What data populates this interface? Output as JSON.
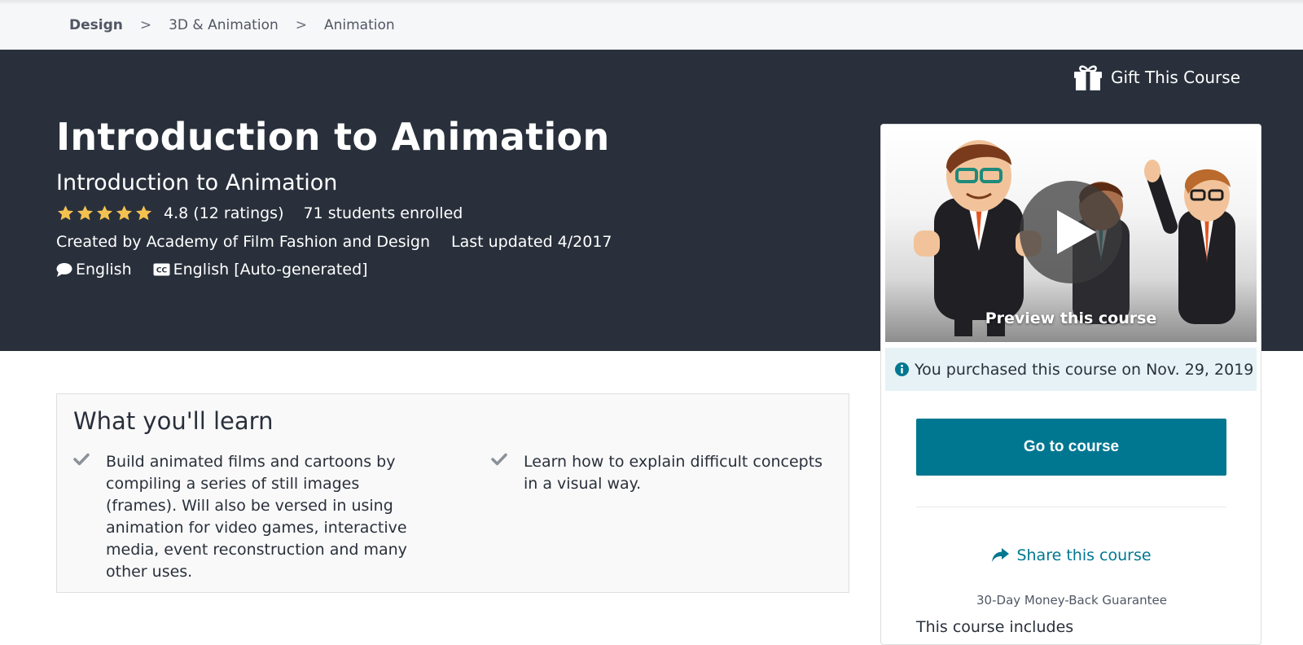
{
  "breadcrumb": [
    {
      "label": "Design"
    },
    {
      "label": "3D & Animation"
    },
    {
      "label": "Animation"
    }
  ],
  "breadcrumb_separator": ">",
  "hero": {
    "gift_label": "Gift This Course",
    "title": "Introduction to Animation",
    "subtitle": "Introduction to Animation",
    "rating": 4.8,
    "rating_label": "4.8 (12 ratings)",
    "stars_filled": 5,
    "enrolled": "71 students enrolled",
    "created_by": "Created by Academy of Film Fashion and Design",
    "last_updated": "Last updated 4/2017",
    "language": "English",
    "captions": "English [Auto-generated]"
  },
  "sidebar": {
    "preview_label": "Preview this course",
    "purchased_notice": "You purchased this course on Nov. 29, 2019",
    "go_button": "Go to course",
    "share_label": "Share this course",
    "guarantee": "30-Day Money-Back Guarantee",
    "includes_title": "This course includes"
  },
  "learn": {
    "title": "What you'll learn",
    "items": [
      "Build animated films and cartoons by compiling a series of still images (frames). Will also be versed in using animation for video games, interactive media, event reconstruction and many other uses.",
      "Learn how to explain difficult concepts in a visual way."
    ]
  },
  "colors": {
    "hero_bg": "#29303b",
    "accent": "#007791",
    "star": "#f4c150",
    "notice_bg": "#e6f2f5"
  },
  "icons": [
    "gift-icon",
    "star-icon",
    "speech-bubble-icon",
    "closed-captions-icon",
    "play-icon",
    "info-icon",
    "share-icon",
    "check-icon"
  ]
}
